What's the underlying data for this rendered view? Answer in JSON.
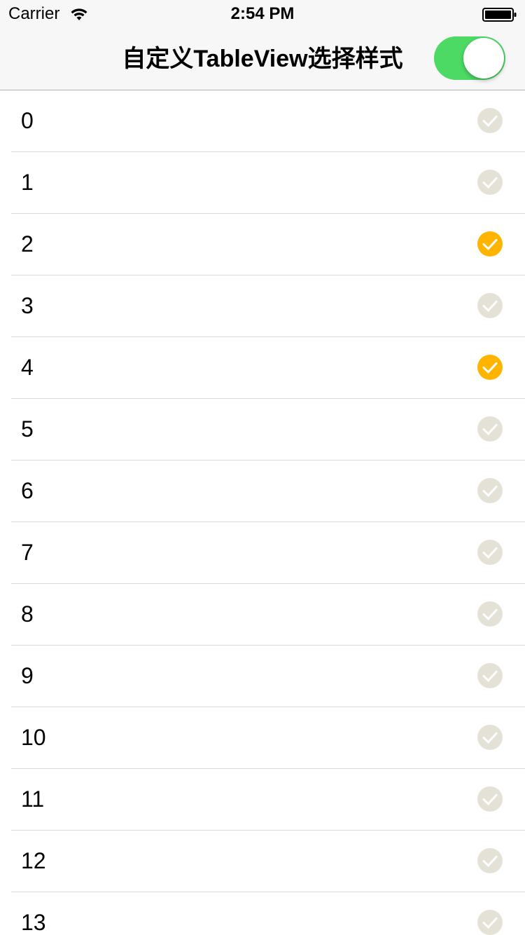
{
  "status_bar": {
    "carrier": "Carrier",
    "time": "2:54 PM",
    "wifi_icon": "wifi-icon",
    "battery_icon": "battery-icon"
  },
  "nav": {
    "title": "自定义TableView选择样式",
    "toggle_on": true
  },
  "colors": {
    "selected": "#ffb400",
    "unselected": "#e4e1d6",
    "toggle_on": "#4cd964"
  },
  "table": {
    "rows": [
      {
        "label": "0",
        "selected": false
      },
      {
        "label": "1",
        "selected": false
      },
      {
        "label": "2",
        "selected": true
      },
      {
        "label": "3",
        "selected": false
      },
      {
        "label": "4",
        "selected": true
      },
      {
        "label": "5",
        "selected": false
      },
      {
        "label": "6",
        "selected": false
      },
      {
        "label": "7",
        "selected": false
      },
      {
        "label": "8",
        "selected": false
      },
      {
        "label": "9",
        "selected": false
      },
      {
        "label": "10",
        "selected": false
      },
      {
        "label": "11",
        "selected": false
      },
      {
        "label": "12",
        "selected": false
      },
      {
        "label": "13",
        "selected": false
      }
    ]
  }
}
